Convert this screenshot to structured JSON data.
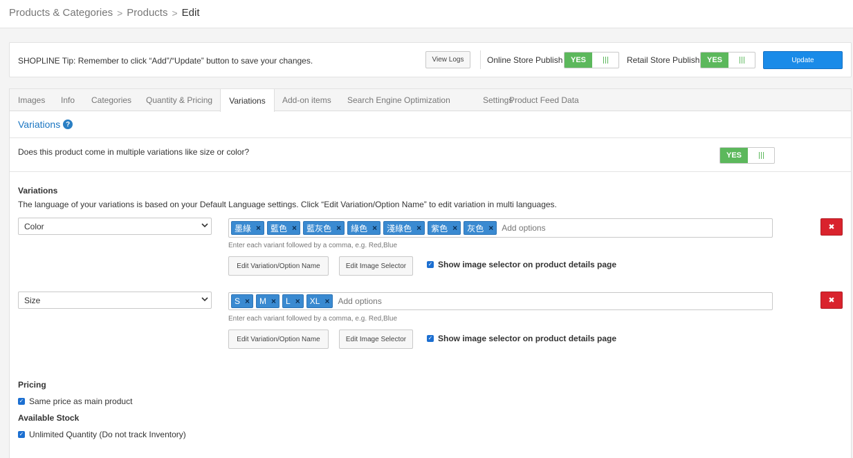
{
  "breadcrumb": {
    "root": "Products & Categories",
    "section": "Products",
    "current": "Edit",
    "separator": ">"
  },
  "tip_bar": {
    "tip": "SHOPLINE Tip: Remember to click “Add”/“Update” button to save your changes.",
    "view_logs": "View Logs",
    "online_label": "Online Store Publish",
    "retail_label": "Retail Store Publish",
    "toggle_yes": "YES",
    "update": "Update",
    "colors": {
      "toggle_on": "#5cb85c",
      "primary": "#1a8be8"
    }
  },
  "tabs": [
    {
      "label": "Images"
    },
    {
      "label": "Info"
    },
    {
      "label": "Categories"
    },
    {
      "label": "Quantity & Pricing"
    },
    {
      "label": "Variations",
      "active": true
    },
    {
      "label": "Add-on items"
    },
    {
      "label": "Search Engine Optimization"
    },
    {
      "label": "Settings"
    },
    {
      "label": "Product Feed Data"
    }
  ],
  "variations_section": {
    "title": "Variations",
    "help_icon": "?",
    "question": "Does this product come in multiple variations like size or color?",
    "toggle_yes": "YES",
    "heading": "Variations",
    "description": "The language of your variations is based on your Default Language settings. Click “Edit Variation/Option Name” to edit variation in multi languages.",
    "rows": [
      {
        "type": "Color",
        "options": [
          "墨綠",
          "藍色",
          "藍灰色",
          "綠色",
          "淺綠色",
          "紫色",
          "灰色"
        ],
        "placeholder": "Add options",
        "hint": "Enter each variant followed by a comma, e.g. Red,Blue",
        "edit_name": "Edit Variation/Option Name",
        "edit_image": "Edit Image Selector",
        "show_image_label": "Show image selector on product details page",
        "show_image_checked": true
      },
      {
        "type": "Size",
        "options": [
          "S",
          "M",
          "L",
          "XL"
        ],
        "placeholder": "Add options",
        "hint": "Enter each variant followed by a comma, e.g. Red,Blue",
        "edit_name": "Edit Variation/Option Name",
        "edit_image": "Edit Image Selector",
        "show_image_label": "Show image selector on product details page",
        "show_image_checked": true
      }
    ],
    "remove_icon": "✖",
    "tag_remove": "×"
  },
  "pricing": {
    "heading": "Pricing",
    "same_price_label": "Same price as main product",
    "same_price_checked": true
  },
  "stock": {
    "heading": "Available Stock",
    "unlimited_label": "Unlimited Quantity (Do not track Inventory)",
    "unlimited_checked": true
  }
}
